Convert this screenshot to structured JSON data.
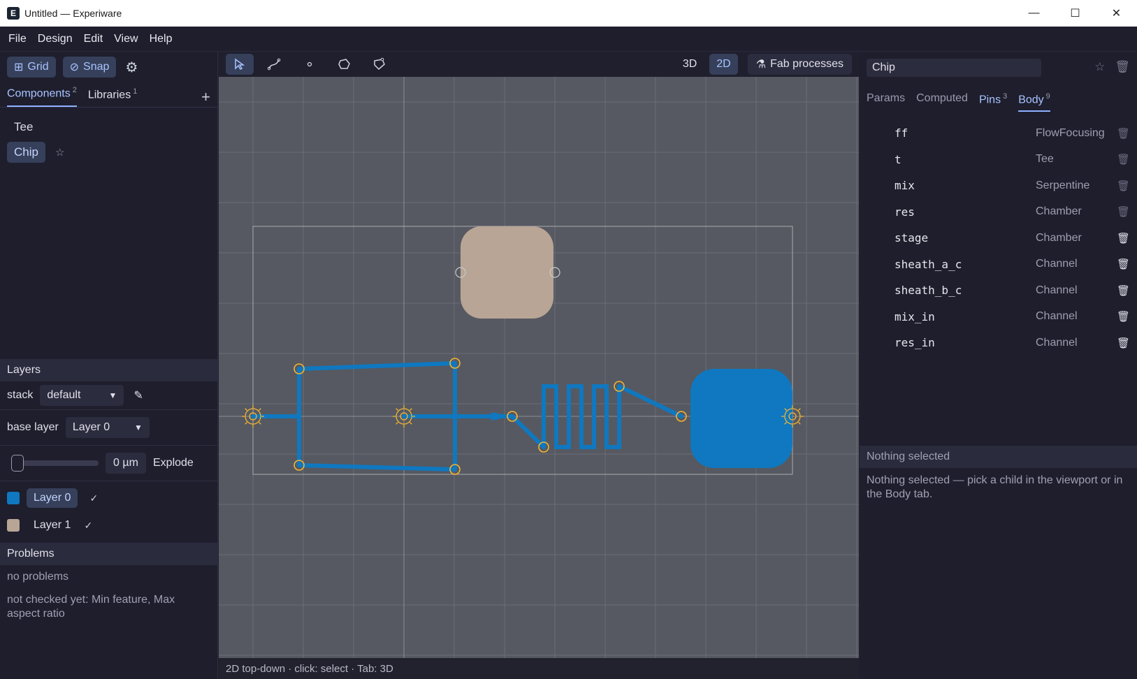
{
  "window": {
    "title": "Untitled — Experiware",
    "app_icon": "E",
    "controls": [
      "minimize-icon",
      "maximize-icon",
      "close-icon"
    ]
  },
  "menu": [
    "File",
    "Design",
    "Edit",
    "View",
    "Help"
  ],
  "left": {
    "grid_label": "Grid",
    "snap_label": "Snap",
    "tabs": [
      {
        "label": "Components",
        "count": "2"
      },
      {
        "label": "Libraries",
        "count": "1"
      }
    ],
    "components": [
      "Tee",
      "Chip"
    ],
    "selected_component": "Chip",
    "layers_header": "Layers",
    "stack_label": "stack",
    "stack_value": "default",
    "base_layer_label": "base layer",
    "base_layer_value": "Layer 0",
    "explode_value": "0 µm",
    "explode_label": "Explode",
    "layer_items": [
      {
        "name": "Layer 0",
        "color": "#0f78c0",
        "checked": "✓"
      },
      {
        "name": "Layer 1",
        "color": "#b8a595",
        "checked": "✓"
      }
    ],
    "problems_header": "Problems",
    "problems_status": "no problems",
    "problems_note": "not checked yet: Min feature, Max aspect ratio"
  },
  "viewport": {
    "mode_3d": "3D",
    "mode_2d": "2D",
    "fab_label": "Fab processes",
    "status": "2D top-down · click: select · Tab: 3D",
    "colors": {
      "channel": "#0f78c0",
      "chamber": "#b8a595",
      "pin": "#f5b530",
      "background": "#565961"
    }
  },
  "right": {
    "name_value": "Chip",
    "tabs": [
      {
        "label": "Params",
        "count": ""
      },
      {
        "label": "Computed",
        "count": ""
      },
      {
        "label": "Pins",
        "count": "3"
      },
      {
        "label": "Body",
        "count": "9"
      }
    ],
    "body": [
      {
        "name": "ff",
        "type": "FlowFocusing"
      },
      {
        "name": "t",
        "type": "Tee"
      },
      {
        "name": "mix",
        "type": "Serpentine"
      },
      {
        "name": "res",
        "type": "Chamber"
      },
      {
        "name": "stage",
        "type": "Chamber"
      },
      {
        "name": "sheath_a_c",
        "type": "Channel"
      },
      {
        "name": "sheath_b_c",
        "type": "Channel"
      },
      {
        "name": "mix_in",
        "type": "Channel"
      },
      {
        "name": "res_in",
        "type": "Channel"
      }
    ],
    "selection_header": "Nothing selected",
    "selection_text": "Nothing selected — pick a child in the viewport or in the Body tab."
  }
}
